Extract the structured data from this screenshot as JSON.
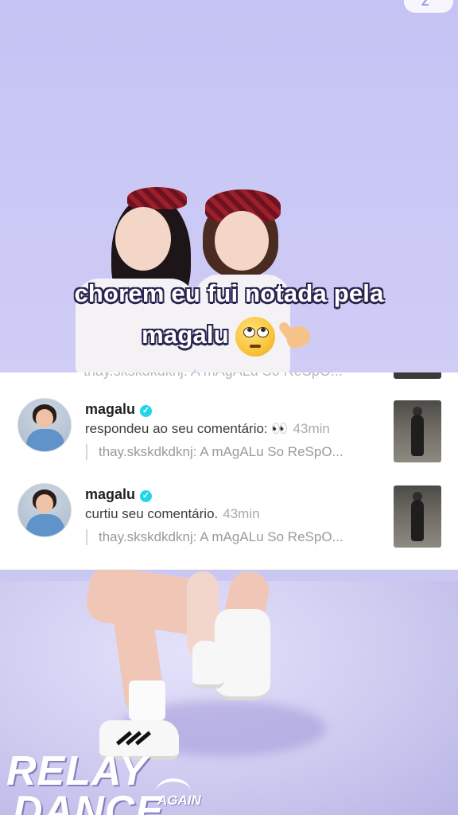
{
  "overlay_caption": {
    "line1": "chorem eu fui notada pela",
    "line2": "magalu"
  },
  "emojis": [
    "face-with-rolling-eyes",
    "call-me-hand"
  ],
  "top_badge": "Z",
  "notifications": {
    "cut_top_text": "thay.skskdkdknj: A mAgALu So ReSpO...",
    "items": [
      {
        "username": "magalu",
        "verified": true,
        "action": "respondeu ao seu comentário: 👀",
        "time": "43min",
        "reply": "thay.skskdkdknj: A mAgALu So ReSpO..."
      },
      {
        "username": "magalu",
        "verified": true,
        "action": "curtiu seu comentário.",
        "time": "43min",
        "reply": "thay.skskdkdknj: A mAgALu So ReSpO..."
      }
    ]
  },
  "logo": {
    "line1": "RELAY",
    "line2": "DANCE",
    "tag": "AGAIN"
  }
}
